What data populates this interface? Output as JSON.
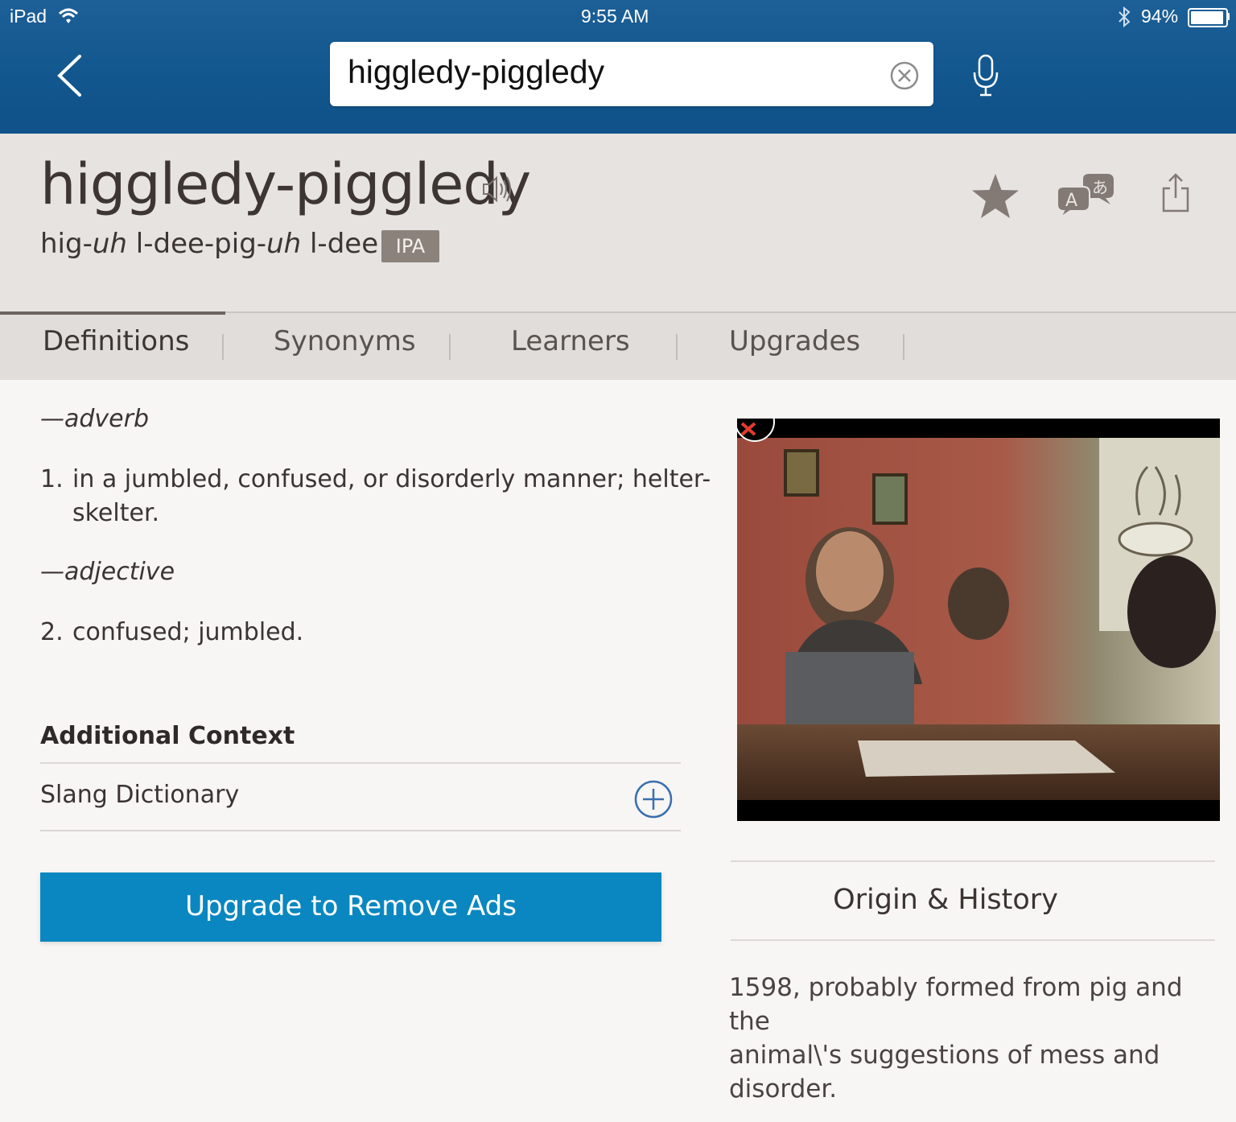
{
  "status_bar": {
    "device": "iPad",
    "time": "9:55 AM",
    "battery": "94%"
  },
  "search": {
    "query": "higgledy-piggledy"
  },
  "entry": {
    "word": "higgledy-piggledy",
    "pron_parts": [
      "hig-",
      "uh",
      " l-dee-pig-",
      "uh",
      " l-dee"
    ],
    "ipa_label": "IPA"
  },
  "tabs": [
    "Definitions",
    "Synonyms",
    "Learners",
    "Upgrades"
  ],
  "definitions": {
    "pos1": "—adverb",
    "def1_num": "1.",
    "def1_line1": "in a jumbled, confused, or disorderly manner; helter-",
    "def1_line2": "skelter.",
    "pos2": "—adjective",
    "def2_num": "2.",
    "def2_text": "confused; jumbled."
  },
  "additional_context": {
    "title": "Additional Context",
    "item": "Slang Dictionary"
  },
  "upgrade_button": "Upgrade to Remove Ads",
  "origin": {
    "title": "Origin & History",
    "line1": "1598, probably formed from pig and the",
    "line2": "animal\\'s suggestions of mess and",
    "line3": "disorder."
  },
  "colors": {
    "topbar": "#13578f",
    "button": "#0a87c0",
    "header_bg": "#e6e3e1",
    "ipa_badge": "#8c827c"
  }
}
